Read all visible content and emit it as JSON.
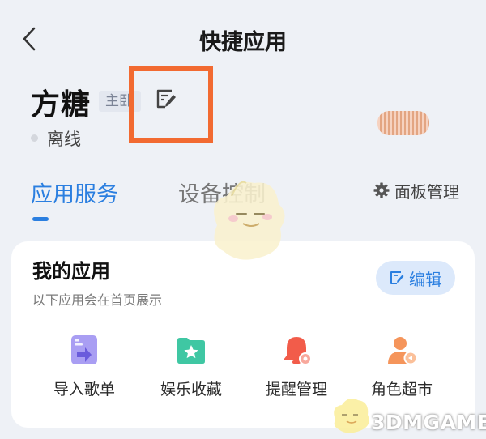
{
  "header": {
    "title": "快捷应用"
  },
  "device": {
    "name": "方糖",
    "tag": "主卧",
    "status": "离线"
  },
  "tabs": [
    {
      "label": "应用服务",
      "active": true
    },
    {
      "label": "设备控制",
      "active": false
    }
  ],
  "panel_management": {
    "label": "面板管理",
    "icon": "gear-icon"
  },
  "my_apps": {
    "title": "我的应用",
    "subtitle": "以下应用会在首页展示",
    "edit_label": "编辑",
    "items": [
      {
        "label": "导入歌单",
        "icon": "playlist-import-icon"
      },
      {
        "label": "娱乐收藏",
        "icon": "folder-star-icon"
      },
      {
        "label": "提醒管理",
        "icon": "bell-icon"
      },
      {
        "label": "角色超市",
        "icon": "user-voice-icon"
      }
    ]
  },
  "watermark": {
    "text": "3DMGAME"
  },
  "colors": {
    "accent": "#2b7fe0",
    "highlight": "#f26a31",
    "background": "#eef1f6"
  }
}
